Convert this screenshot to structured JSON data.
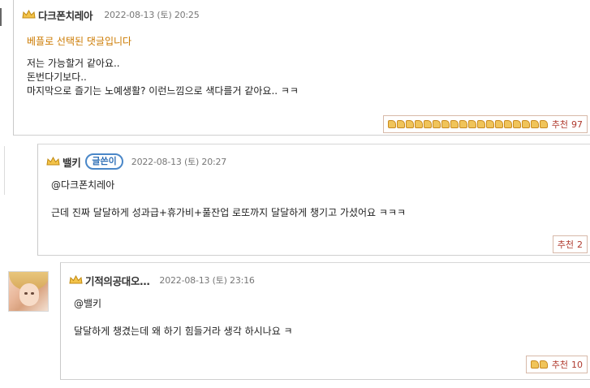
{
  "comments": [
    {
      "nickname": "다크폰치레아",
      "date": "2022-08-13 (토) 20:25",
      "best_label": "베플로 선택된 댓글입니다",
      "lines": [
        "저는 가능할거 같아요..",
        "돈번다기보다..",
        "마지막으로 즐기는 노예생활? 이런느낌으로 색다를거 같아요.. ㅋㅋ"
      ],
      "recommend_label": "추천",
      "recommend_count": "97",
      "thumb_count": 18
    },
    {
      "nickname": "밸키",
      "writer_badge": "글쓴이",
      "date": "2022-08-13 (토) 20:27",
      "lines": [
        "@다크폰치레아",
        "",
        "근데 진짜 달달하게 성과급+휴가비+풀잔업 로또까지 달달하게 챙기고 가셨어요 ㅋㅋㅋ"
      ],
      "recommend_label": "추천",
      "recommend_count": "2",
      "thumb_count": 0
    },
    {
      "nickname": "기적의공대오…",
      "date": "2022-08-13 (토) 23:16",
      "lines": [
        "@밸키",
        "",
        "달달하게 챙겼는데 왜 하기 힘들거라 생각 하시나요 ㅋ"
      ],
      "recommend_label": "추천",
      "recommend_count": "10",
      "thumb_count": 2
    }
  ],
  "icons": {
    "level_badge": "crown-icon",
    "thumb": "thumbs-up-icon",
    "avatar": "profile-photo"
  },
  "colors": {
    "best_text": "#cc7a00",
    "recommend_text": "#b03a2e",
    "badge_blue": "#2f6fb6"
  }
}
